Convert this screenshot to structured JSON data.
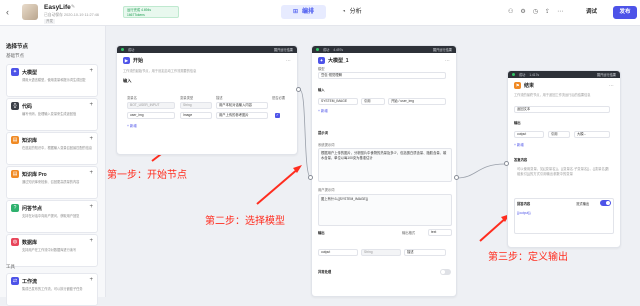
{
  "topbar": {
    "back": "‹",
    "app_name": "EasyLife",
    "save_status": "已自动保存 2020-10-19 11:27:46",
    "fixed_tag": "开发",
    "run_status_line1": "运行完成 4.694s",
    "run_status_line2": "1667Tokens",
    "tabs": [
      {
        "label": "编排",
        "icon": "flow-icon"
      },
      {
        "label": "分析",
        "icon": "chart-icon"
      }
    ],
    "debug_label": "调试",
    "publish_label": "发布",
    "colors": {
      "accent": "#4d53e8",
      "success": "#1e9d52"
    }
  },
  "sidebar": {
    "title": "选择节点",
    "section_basic": "基础节点",
    "section_tools": "工具",
    "items": [
      {
        "name": "大模型",
        "desc": "调用大语言模型，使用变量和提示词生成回复",
        "color": "#4d53e8",
        "glyph": "✦"
      },
      {
        "name": "代码",
        "desc": "编写代码，处理输入变量来生成返回值",
        "color": "#3b3f48",
        "glyph": "{}"
      },
      {
        "name": "知识库",
        "desc": "在选定的知识中，根据输入变量召回最匹配的信息",
        "color": "#f08a24",
        "glyph": "▤"
      },
      {
        "name": "知识库 Pro",
        "desc": "通过知识库来检索、召回更高质量的内容",
        "color": "#f08a24",
        "glyph": "▤"
      },
      {
        "name": "问答节点",
        "desc": "支持在对话中向用户提问，获取用户回复",
        "color": "#2fb16e",
        "glyph": "?"
      },
      {
        "name": "数据库",
        "desc": "支持用户在工作流中对数据库进行读写",
        "color": "#e8455a",
        "glyph": "◍"
      },
      {
        "name": "工作流",
        "desc": "集成已发布的工作流，可以执行嵌套子任务",
        "color": "#4d53e8",
        "glyph": "⇄"
      }
    ]
  },
  "start_node": {
    "strip": "成功",
    "strip_right": "展开运行结果",
    "title": "开始",
    "desc": "工作流的起始节点，用于设定启动工作流需要的信息",
    "section": "输入",
    "col_name": "变量名",
    "col_type": "变量类型",
    "col_desc": "描述",
    "col_req": "是否必要",
    "rows": [
      {
        "name": "BOT_USER_INPUT",
        "type": "String",
        "desc": "用户本轮对话输入内容"
      },
      {
        "name": "user_img",
        "type": "Image",
        "desc": "用户上传的参考图片"
      }
    ],
    "add": "+ 新增"
  },
  "llm_node": {
    "strip": "成功",
    "strip_time": "4.497s",
    "strip_right": "展开运行结果",
    "title": "大模型_1",
    "model_label": "模型",
    "model_value": "豆包·视觉理解",
    "section_input": "输入",
    "in_name": "SYSTEM_IMAGE",
    "in_type": "引用",
    "in_value": "开始 / user_img",
    "add": "+ 新增",
    "section_prompt": "提示词",
    "sys_prompt_label": "系统提示词",
    "sys_prompt": "根据用户上传的图片，分析图片中食物的热量及多少，包括蛋白质含量、脂肪含量、碳水含量，单位以每100克为基准估计",
    "user_prompt_label": "用户提示词",
    "user_prompt": "图上有什么{{SYSTEM_IMAGE}}",
    "section_output": "输出",
    "output_format_label": "输出格式",
    "output_format": "text",
    "out_name": "output",
    "out_type": "String",
    "out_desc": "描述",
    "exception_label": "异常处理"
  },
  "end_node": {
    "strip": "成功",
    "strip_time": "1.417s",
    "strip_right": "展开运行结果",
    "title": "结束",
    "desc": "工作流的最终节点，用于返回工作流运行后的结果信息",
    "mode": "返回文本",
    "section_output": "输出",
    "out_name": "output",
    "out_type": "引用",
    "out_value": "大模...",
    "add": "+ 新增",
    "section_reply": "答复内容",
    "reply_text": "可以使用变量，如{{变量名}}，{{变量名.子变量名}}，{{变量名[数组索引]}}的方式引用输出参数中的变量",
    "section_reply_var": "回答内容",
    "stream_label": "流式输出",
    "reply_var": "{{output}}"
  },
  "annotations": {
    "step1": "第一步：开始节点",
    "step2": "第二步：选择模型",
    "step3": "第三步：定义输出"
  }
}
